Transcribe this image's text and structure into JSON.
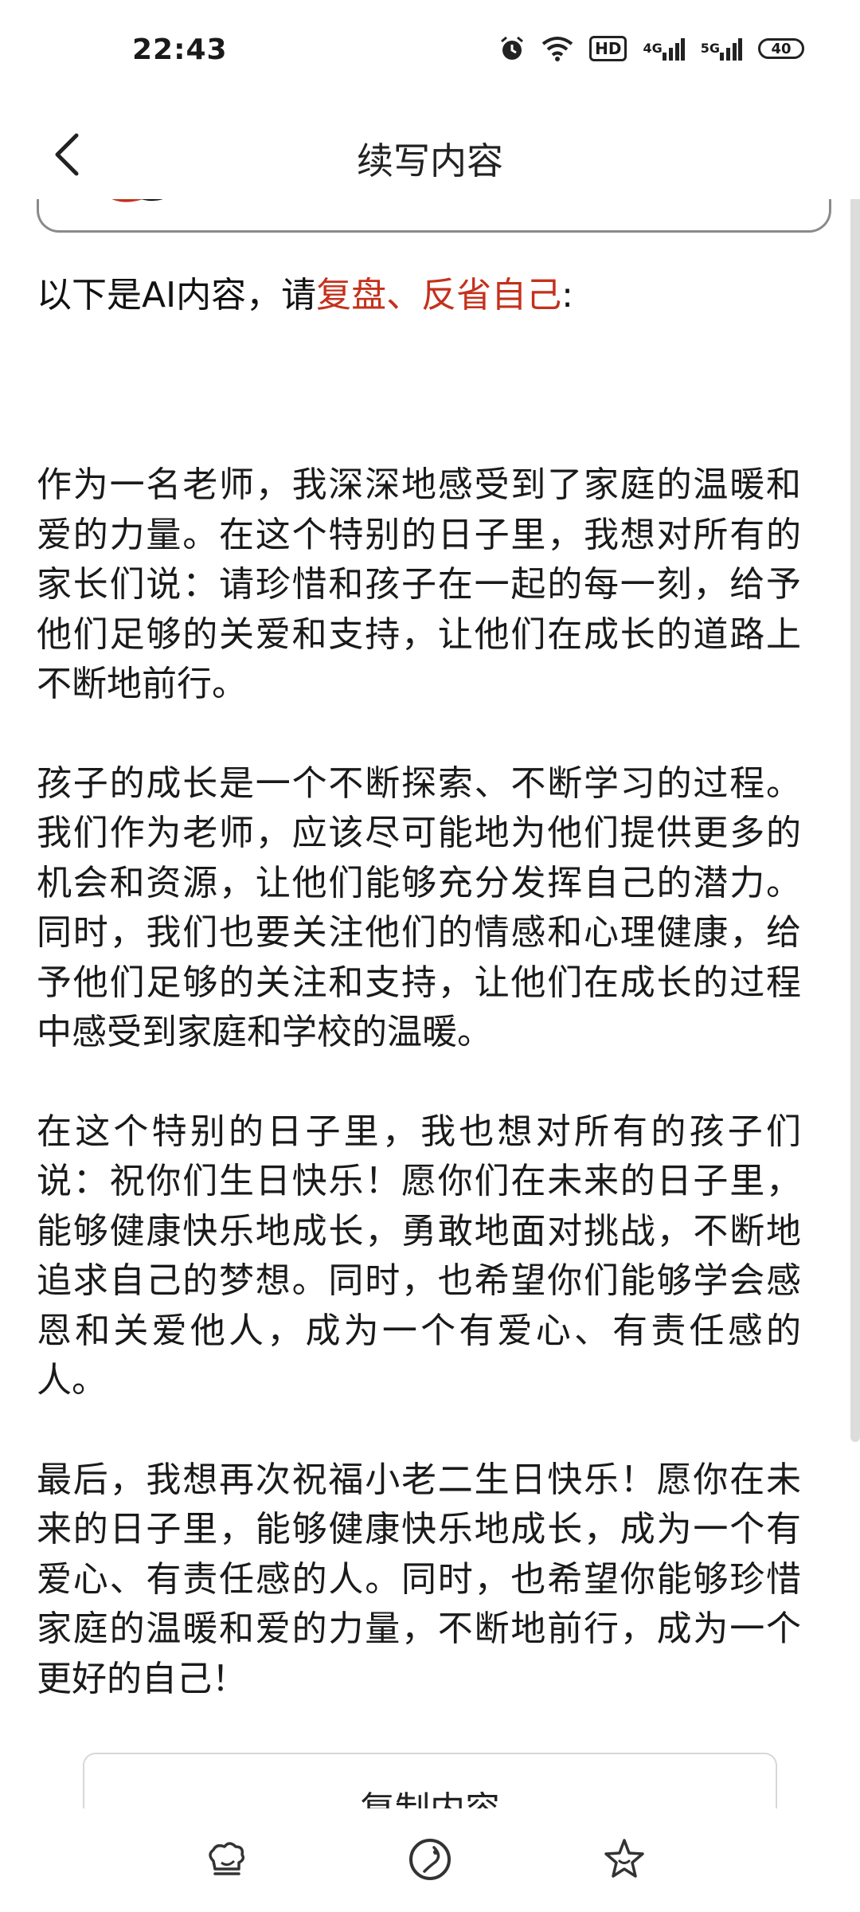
{
  "status_bar": {
    "time": "22:43",
    "icons": [
      "alarm-icon",
      "wifi-icon",
      "hd-icon",
      "signal-4g-icon",
      "signal-5g-icon",
      "battery-icon"
    ],
    "hd_label": "HD",
    "network_4g": "4G",
    "network_5g": "5G",
    "battery_level": "40"
  },
  "header": {
    "back_icon": "chevron-left-icon",
    "title": "续写内容"
  },
  "prompt": {
    "prefix": "以下是AI内容，请",
    "highlight": "复盘、反省自己",
    "suffix": ":"
  },
  "paragraphs": [
    "作为一名老师，我深深地感受到了家庭的温暖和爱的力量。在这个特别的日子里，我想对所有的家长们说：请珍惜和孩子在一起的每一刻，给予他们足够的关爱和支持，让他们在成长的道路上不断地前行。",
    "孩子的成长是一个不断探索、不断学习的过程。我们作为老师，应该尽可能地为他们提供更多的机会和资源，让他们能够充分发挥自己的潜力。同时，我们也要关注他们的情感和心理健康，给予他们足够的关注和支持，让他们在成长的过程中感受到家庭和学校的温暖。",
    "在这个特别的日子里，我也想对所有的孩子们说：祝你们生日快乐！愿你们在未来的日子里，能够健康快乐地成长，勇敢地面对挑战，不断地追求自己的梦想。同时，也希望你们能够学会感恩和关爱他人，成为一个有爱心、有责任感的人。",
    "最后，我想再次祝福小老二生日快乐！愿你在未来的日子里，能够健康快乐地成长，成为一个有爱心、有责任感的人。同时，也希望你能够珍惜家庭的温暖和爱的力量，不断地前行，成为一个更好的自己！"
  ],
  "copy_button": {
    "label": "复制内容"
  },
  "bottom_nav": {
    "items": [
      {
        "icon": "chef-hat-icon"
      },
      {
        "icon": "explore-icon"
      },
      {
        "icon": "star-face-icon"
      }
    ]
  },
  "colors": {
    "accent": "#c4311c",
    "text": "#1a1a1a"
  }
}
